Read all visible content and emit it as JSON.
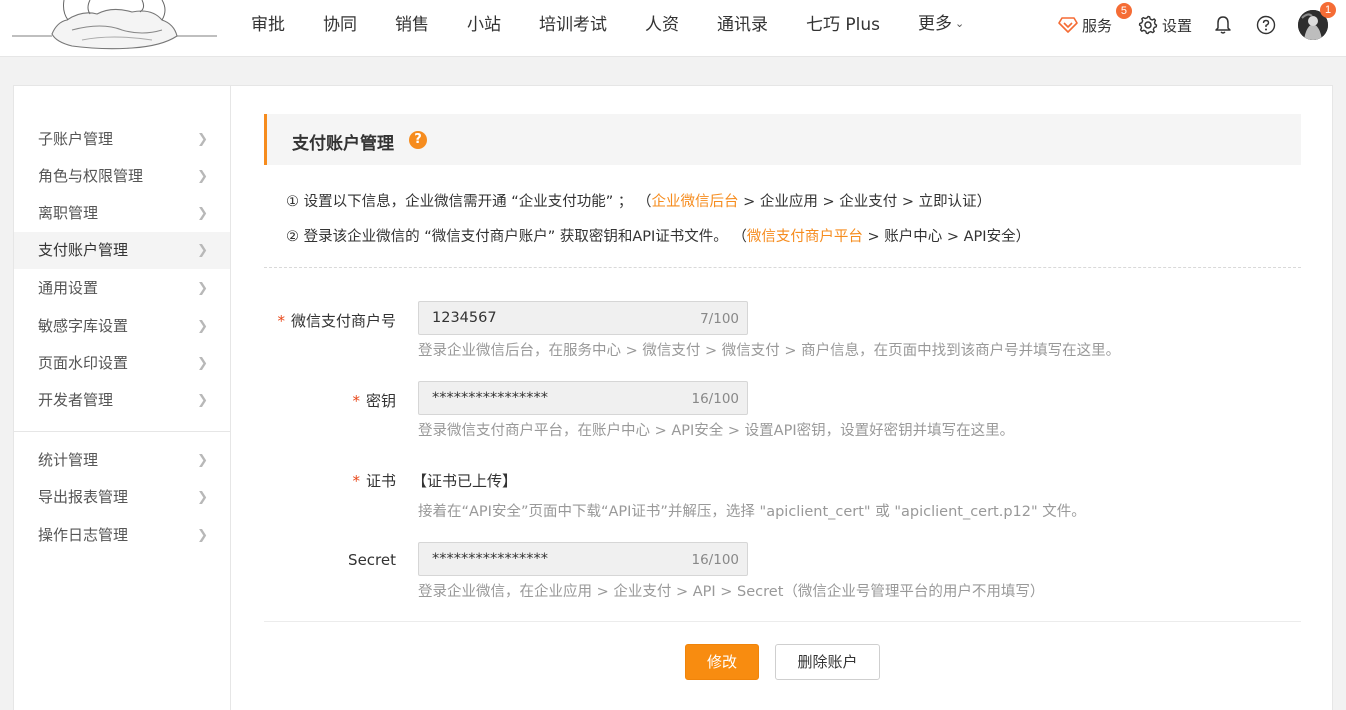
{
  "nav": {
    "items": [
      "审批",
      "协同",
      "销售",
      "小站",
      "培训考试",
      "人资",
      "通讯录",
      "七巧 Plus"
    ],
    "more_label": "更多"
  },
  "tools": {
    "service_label": "服务",
    "service_badge": "5",
    "settings_label": "设置",
    "avatar_badge": "1"
  },
  "sidebar": {
    "group1": [
      "子账户管理",
      "角色与权限管理",
      "离职管理",
      "支付账户管理",
      "通用设置",
      "敏感字库设置",
      "页面水印设置",
      "开发者管理"
    ],
    "group2": [
      "统计管理",
      "导出报表管理",
      "操作日志管理"
    ],
    "active": "支付账户管理"
  },
  "page": {
    "title": "支付账户管理",
    "help_glyph": "?"
  },
  "tips": {
    "t1_prefix": "① 设置以下信息，企业微信需开通 “企业支付功能” ；   （",
    "t1_link": "企业微信后台",
    "t1_suffix": " > 企业应用 > 企业支付 > 立即认证）",
    "t2_prefix": "② 登录该企业微信的 “微信支付商户账户” 获取密钥和API证书文件。  （",
    "t2_link": "微信支付商户平台",
    "t2_suffix": " > 账户中心 > API安全）"
  },
  "form": {
    "merchant": {
      "label": "微信支付商户号",
      "value": "1234567",
      "count": "7/100",
      "help": "登录企业微信后台，在服务中心 > 微信支付 > 微信支付 > 商户信息，在页面中找到该商户号并填写在这里。"
    },
    "key": {
      "label": "密钥",
      "value": "****************",
      "count": "16/100",
      "help": "登录微信支付商户平台，在账户中心 > API安全 > 设置API密钥，设置好密钥并填写在这里。"
    },
    "cert": {
      "label": "证书",
      "status": "【证书已上传】",
      "help": "接着在“API安全”页面中下载“API证书”并解压，选择 \"apiclient_cert\" 或 \"apiclient_cert.p12\" 文件。"
    },
    "secret": {
      "label": "Secret",
      "value": "****************",
      "count": "16/100",
      "help": "登录企业微信，在企业应用 > 企业支付 > API > Secret（微信企业号管理平台的用户不用填写）"
    },
    "required_mark": "*"
  },
  "buttons": {
    "modify": "修改",
    "delete": "删除账户"
  },
  "colors": {
    "accent": "#f68c1e",
    "badge": "#f56c35",
    "required": "#e8481a"
  }
}
